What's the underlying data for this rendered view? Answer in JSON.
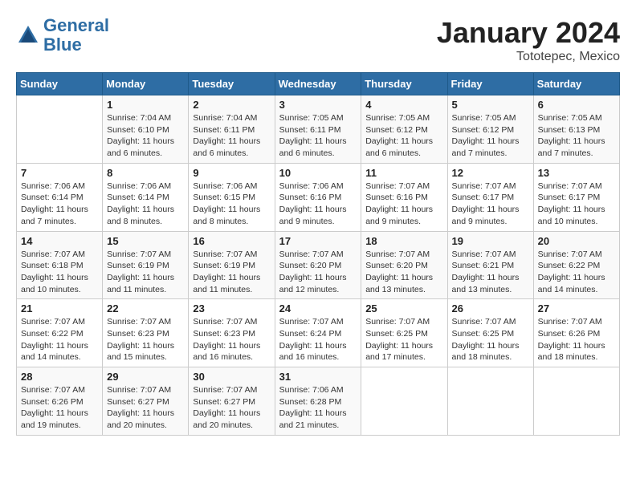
{
  "header": {
    "logo_line1": "General",
    "logo_line2": "Blue",
    "month": "January 2024",
    "location": "Tototepec, Mexico"
  },
  "days_of_week": [
    "Sunday",
    "Monday",
    "Tuesday",
    "Wednesday",
    "Thursday",
    "Friday",
    "Saturday"
  ],
  "weeks": [
    [
      {
        "day": "",
        "info": ""
      },
      {
        "day": "1",
        "info": "Sunrise: 7:04 AM\nSunset: 6:10 PM\nDaylight: 11 hours and 6 minutes."
      },
      {
        "day": "2",
        "info": "Sunrise: 7:04 AM\nSunset: 6:11 PM\nDaylight: 11 hours and 6 minutes."
      },
      {
        "day": "3",
        "info": "Sunrise: 7:05 AM\nSunset: 6:11 PM\nDaylight: 11 hours and 6 minutes."
      },
      {
        "day": "4",
        "info": "Sunrise: 7:05 AM\nSunset: 6:12 PM\nDaylight: 11 hours and 6 minutes."
      },
      {
        "day": "5",
        "info": "Sunrise: 7:05 AM\nSunset: 6:12 PM\nDaylight: 11 hours and 7 minutes."
      },
      {
        "day": "6",
        "info": "Sunrise: 7:05 AM\nSunset: 6:13 PM\nDaylight: 11 hours and 7 minutes."
      }
    ],
    [
      {
        "day": "7",
        "info": "Sunrise: 7:06 AM\nSunset: 6:14 PM\nDaylight: 11 hours and 7 minutes."
      },
      {
        "day": "8",
        "info": "Sunrise: 7:06 AM\nSunset: 6:14 PM\nDaylight: 11 hours and 8 minutes."
      },
      {
        "day": "9",
        "info": "Sunrise: 7:06 AM\nSunset: 6:15 PM\nDaylight: 11 hours and 8 minutes."
      },
      {
        "day": "10",
        "info": "Sunrise: 7:06 AM\nSunset: 6:16 PM\nDaylight: 11 hours and 9 minutes."
      },
      {
        "day": "11",
        "info": "Sunrise: 7:07 AM\nSunset: 6:16 PM\nDaylight: 11 hours and 9 minutes."
      },
      {
        "day": "12",
        "info": "Sunrise: 7:07 AM\nSunset: 6:17 PM\nDaylight: 11 hours and 9 minutes."
      },
      {
        "day": "13",
        "info": "Sunrise: 7:07 AM\nSunset: 6:17 PM\nDaylight: 11 hours and 10 minutes."
      }
    ],
    [
      {
        "day": "14",
        "info": "Sunrise: 7:07 AM\nSunset: 6:18 PM\nDaylight: 11 hours and 10 minutes."
      },
      {
        "day": "15",
        "info": "Sunrise: 7:07 AM\nSunset: 6:19 PM\nDaylight: 11 hours and 11 minutes."
      },
      {
        "day": "16",
        "info": "Sunrise: 7:07 AM\nSunset: 6:19 PM\nDaylight: 11 hours and 11 minutes."
      },
      {
        "day": "17",
        "info": "Sunrise: 7:07 AM\nSunset: 6:20 PM\nDaylight: 11 hours and 12 minutes."
      },
      {
        "day": "18",
        "info": "Sunrise: 7:07 AM\nSunset: 6:20 PM\nDaylight: 11 hours and 13 minutes."
      },
      {
        "day": "19",
        "info": "Sunrise: 7:07 AM\nSunset: 6:21 PM\nDaylight: 11 hours and 13 minutes."
      },
      {
        "day": "20",
        "info": "Sunrise: 7:07 AM\nSunset: 6:22 PM\nDaylight: 11 hours and 14 minutes."
      }
    ],
    [
      {
        "day": "21",
        "info": "Sunrise: 7:07 AM\nSunset: 6:22 PM\nDaylight: 11 hours and 14 minutes."
      },
      {
        "day": "22",
        "info": "Sunrise: 7:07 AM\nSunset: 6:23 PM\nDaylight: 11 hours and 15 minutes."
      },
      {
        "day": "23",
        "info": "Sunrise: 7:07 AM\nSunset: 6:23 PM\nDaylight: 11 hours and 16 minutes."
      },
      {
        "day": "24",
        "info": "Sunrise: 7:07 AM\nSunset: 6:24 PM\nDaylight: 11 hours and 16 minutes."
      },
      {
        "day": "25",
        "info": "Sunrise: 7:07 AM\nSunset: 6:25 PM\nDaylight: 11 hours and 17 minutes."
      },
      {
        "day": "26",
        "info": "Sunrise: 7:07 AM\nSunset: 6:25 PM\nDaylight: 11 hours and 18 minutes."
      },
      {
        "day": "27",
        "info": "Sunrise: 7:07 AM\nSunset: 6:26 PM\nDaylight: 11 hours and 18 minutes."
      }
    ],
    [
      {
        "day": "28",
        "info": "Sunrise: 7:07 AM\nSunset: 6:26 PM\nDaylight: 11 hours and 19 minutes."
      },
      {
        "day": "29",
        "info": "Sunrise: 7:07 AM\nSunset: 6:27 PM\nDaylight: 11 hours and 20 minutes."
      },
      {
        "day": "30",
        "info": "Sunrise: 7:07 AM\nSunset: 6:27 PM\nDaylight: 11 hours and 20 minutes."
      },
      {
        "day": "31",
        "info": "Sunrise: 7:06 AM\nSunset: 6:28 PM\nDaylight: 11 hours and 21 minutes."
      },
      {
        "day": "",
        "info": ""
      },
      {
        "day": "",
        "info": ""
      },
      {
        "day": "",
        "info": ""
      }
    ]
  ]
}
